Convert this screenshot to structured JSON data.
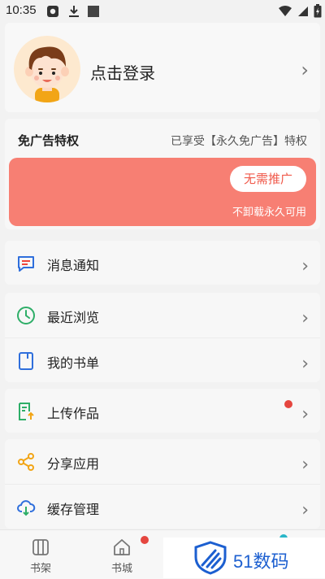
{
  "status_bar": {
    "time": "10:35",
    "icons": [
      "settings-square-icon",
      "download-icon",
      "image-square-icon",
      "wifi-icon",
      "signal-icon",
      "battery-icon"
    ]
  },
  "profile": {
    "login_text": "点击登录",
    "chevron": "›"
  },
  "ad_privilege": {
    "title": "免广告特权",
    "status": "已享受【永久免广告】特权",
    "button": "无需推广",
    "note": "不卸载永久可用",
    "banner_color": "#f77f73"
  },
  "menu": {
    "chevron": "›",
    "notifications": "消息通知",
    "recent": "最近浏览",
    "booklist": "我的书单",
    "upload": "上传作品",
    "share": "分享应用",
    "cache": "缓存管理"
  },
  "tabbar": {
    "bookshelf": "书架",
    "bookstore": "书城"
  },
  "watermark": {
    "text": "51数码"
  },
  "colors": {
    "accent_red": "#e5463f",
    "icon_blue": "#2f6fdc",
    "icon_green": "#2eae68",
    "icon_orange": "#f2a516"
  }
}
